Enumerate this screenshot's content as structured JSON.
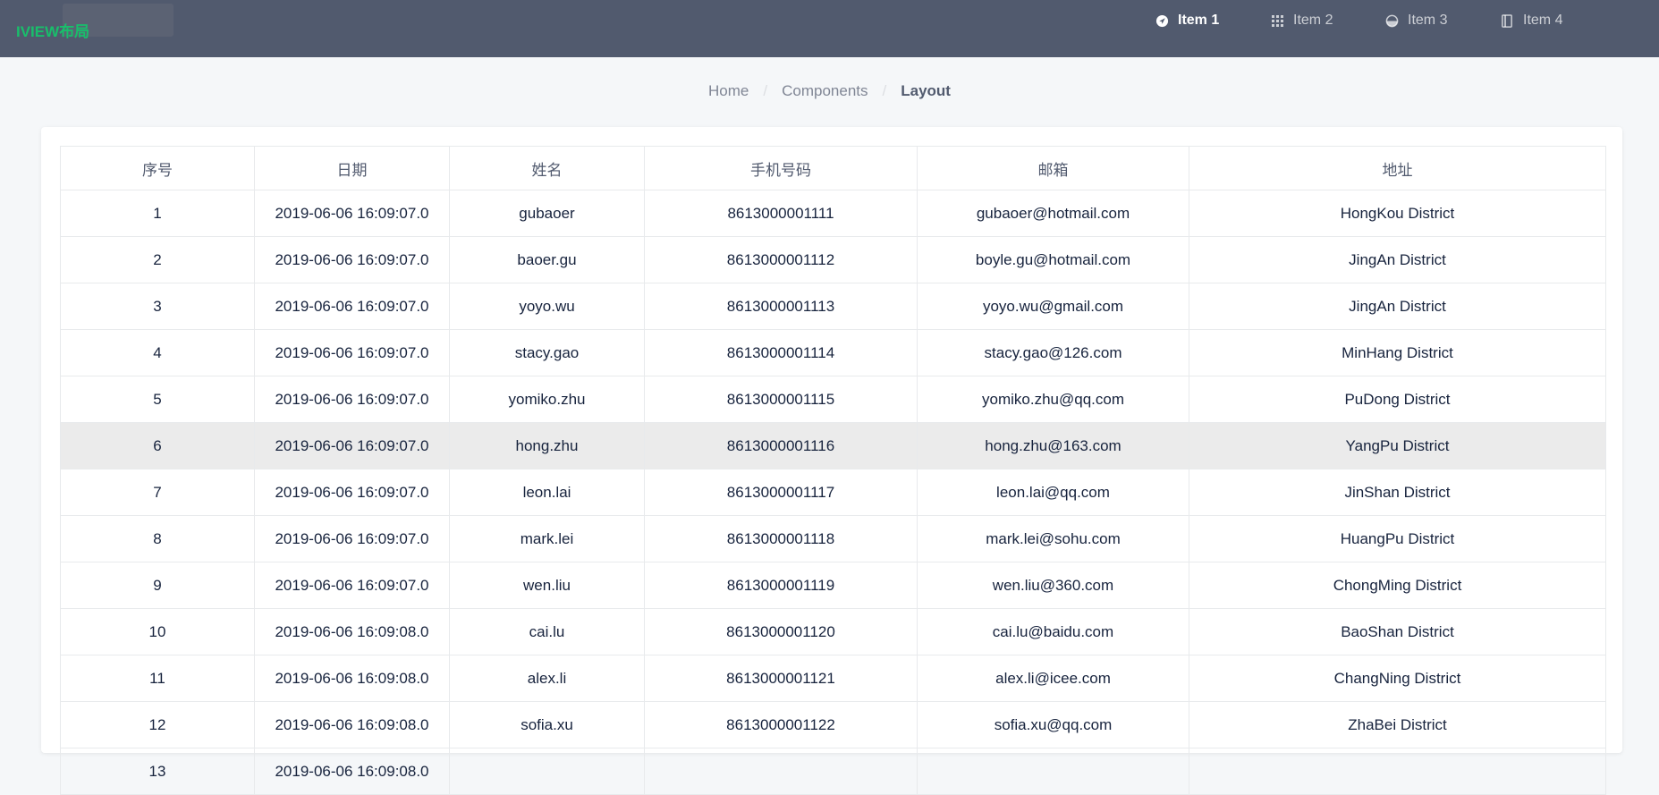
{
  "header": {
    "logo_text": "IVIEW布局",
    "menu": [
      {
        "label": "Item 1",
        "icon": "navigation-icon",
        "active": true
      },
      {
        "label": "Item 2",
        "icon": "grid-icon",
        "active": false
      },
      {
        "label": "Item 3",
        "icon": "pie-icon",
        "active": false
      },
      {
        "label": "Item 4",
        "icon": "book-icon",
        "active": false
      }
    ]
  },
  "breadcrumb": [
    "Home",
    "Components",
    "Layout"
  ],
  "table": {
    "columns": [
      "序号",
      "日期",
      "姓名",
      "手机号码",
      "邮箱",
      "地址"
    ],
    "rows": [
      [
        "1",
        "2019-06-06 16:09:07.0",
        "gubaoer",
        "8613000001111",
        "gubaoer@hotmail.com",
        "HongKou District"
      ],
      [
        "2",
        "2019-06-06 16:09:07.0",
        "baoer.gu",
        "8613000001112",
        "boyle.gu@hotmail.com",
        "JingAn District"
      ],
      [
        "3",
        "2019-06-06 16:09:07.0",
        "yoyo.wu",
        "8613000001113",
        "yoyo.wu@gmail.com",
        "JingAn District"
      ],
      [
        "4",
        "2019-06-06 16:09:07.0",
        "stacy.gao",
        "8613000001114",
        "stacy.gao@126.com",
        "MinHang District"
      ],
      [
        "5",
        "2019-06-06 16:09:07.0",
        "yomiko.zhu",
        "8613000001115",
        "yomiko.zhu@qq.com",
        "PuDong District"
      ],
      [
        "6",
        "2019-06-06 16:09:07.0",
        "hong.zhu",
        "8613000001116",
        "hong.zhu@163.com",
        "YangPu District"
      ],
      [
        "7",
        "2019-06-06 16:09:07.0",
        "leon.lai",
        "8613000001117",
        "leon.lai@qq.com",
        "JinShan District"
      ],
      [
        "8",
        "2019-06-06 16:09:07.0",
        "mark.lei",
        "8613000001118",
        "mark.lei@sohu.com",
        "HuangPu District"
      ],
      [
        "9",
        "2019-06-06 16:09:07.0",
        "wen.liu",
        "8613000001119",
        "wen.liu@360.com",
        "ChongMing District"
      ],
      [
        "10",
        "2019-06-06 16:09:08.0",
        "cai.lu",
        "8613000001120",
        "cai.lu@baidu.com",
        "BaoShan District"
      ],
      [
        "11",
        "2019-06-06 16:09:08.0",
        "alex.li",
        "8613000001121",
        "alex.li@icee.com",
        "ChangNing District"
      ],
      [
        "12",
        "2019-06-06 16:09:08.0",
        "sofia.xu",
        "8613000001122",
        "sofia.xu@qq.com",
        "ZhaBei District"
      ],
      [
        "13",
        "2019-06-06 16:09:08.0",
        "",
        "",
        "",
        ""
      ]
    ],
    "highlighted_row": "6"
  },
  "colors": {
    "header_bg": "#515a6e",
    "logo_green": "#19be6b",
    "page_bg": "#f5f7f9",
    "row_highlight": "#ebebeb"
  }
}
